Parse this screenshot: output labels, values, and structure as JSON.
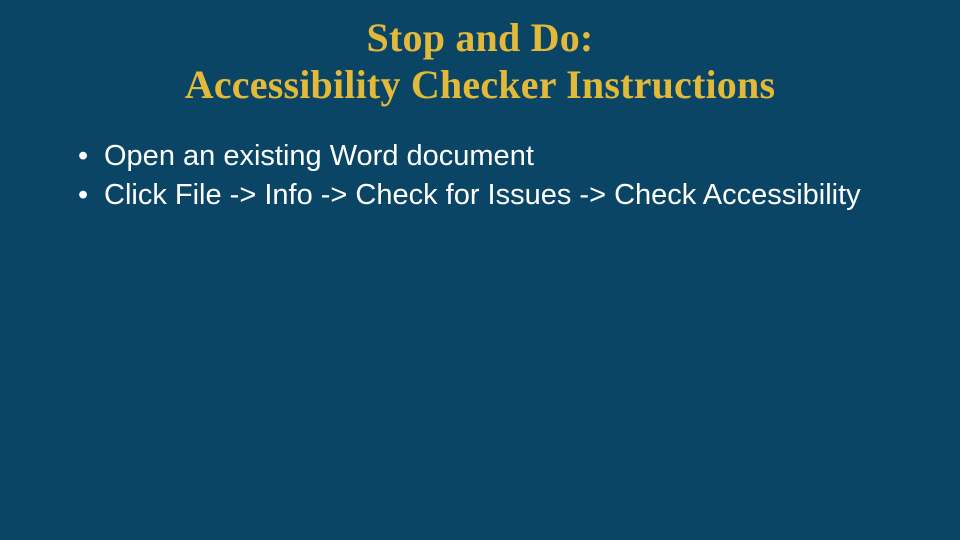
{
  "colors": {
    "background": "#0b4566",
    "title": "#e3b93a",
    "body_text": "#ffffff"
  },
  "title": {
    "line1": "Stop and Do:",
    "line2": "Accessibility Checker Instructions"
  },
  "bullets": [
    "Open an existing Word document",
    "Click File -> Info -> Check for Issues -> Check Accessibility"
  ]
}
